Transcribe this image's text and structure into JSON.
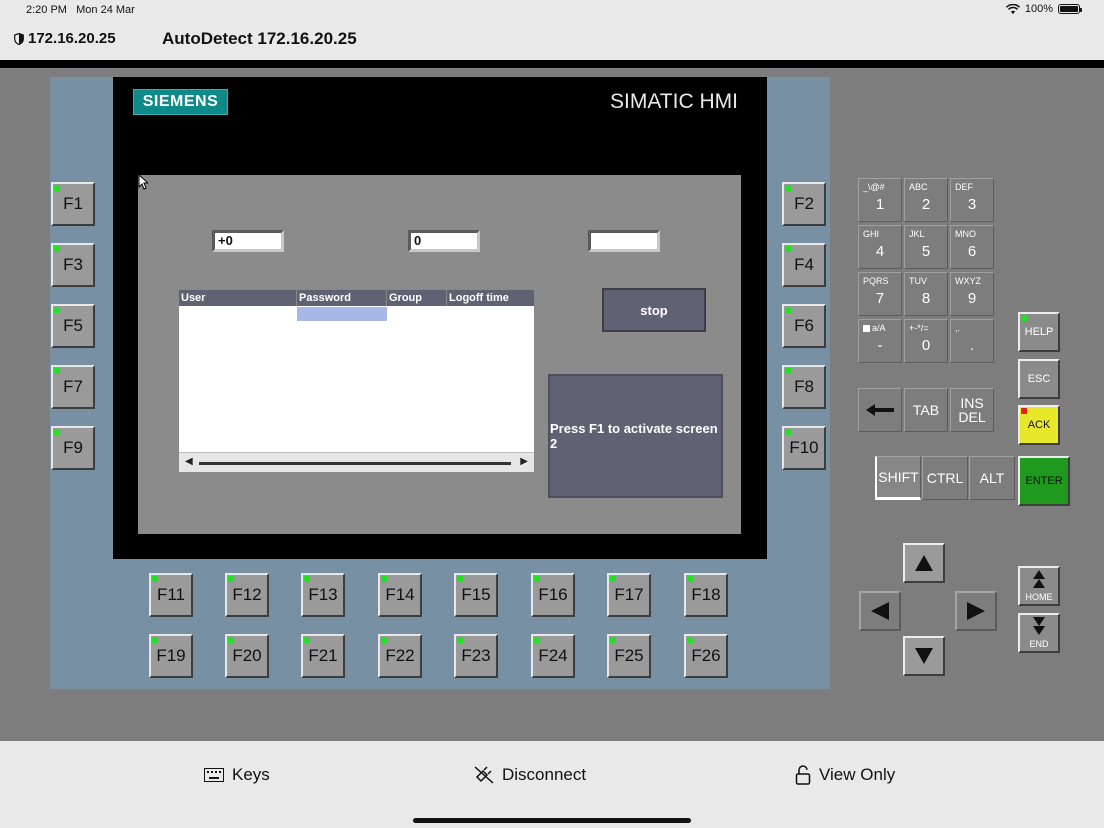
{
  "status": {
    "time": "2:20 PM",
    "date": "Mon 24 Mar",
    "battery": "100%"
  },
  "header": {
    "ip": "172.16.20.25",
    "title": "AutoDetect 172.16.20.25"
  },
  "hmi": {
    "brand_logo": "SIEMENS",
    "brand_product": "SIMATIC HMI",
    "fields": [
      "+0",
      "0",
      ""
    ],
    "stop_label": "stop",
    "press_label": "Press F1 to activate screen 2",
    "table": {
      "columns": [
        "User",
        "Password",
        "Group",
        "Logoff time"
      ]
    }
  },
  "fkeys": {
    "left": [
      "F1",
      "F3",
      "F5",
      "F7",
      "F9"
    ],
    "right": [
      "F2",
      "F4",
      "F6",
      "F8",
      "F10"
    ],
    "bottom_row1": [
      "F11",
      "F12",
      "F13",
      "F14",
      "F15",
      "F16",
      "F17",
      "F18"
    ],
    "bottom_row2": [
      "F19",
      "F20",
      "F21",
      "F22",
      "F23",
      "F24",
      "F25",
      "F26"
    ]
  },
  "keypad": {
    "keys": [
      {
        "sub": "_\\@#",
        "main": "1"
      },
      {
        "sub": "ABC",
        "main": "2"
      },
      {
        "sub": "DEF",
        "main": "3"
      },
      {
        "sub": "GHI",
        "main": "4"
      },
      {
        "sub": "JKL",
        "main": "5"
      },
      {
        "sub": "MNO",
        "main": "6"
      },
      {
        "sub": "PQRS",
        "main": "7"
      },
      {
        "sub": "TUV",
        "main": "8"
      },
      {
        "sub": "WXYZ",
        "main": "9"
      },
      {
        "sub": "a/A",
        "main": "-"
      },
      {
        "sub": "+-*/=",
        "main": "0"
      },
      {
        "sub": ",.",
        "main": "."
      }
    ],
    "tab": "TAB",
    "ins": "INS",
    "del": "DEL",
    "shift": "SHIFT",
    "ctrl": "CTRL",
    "alt": "ALT",
    "help": "HELP",
    "esc": "ESC",
    "ack": "ACK",
    "enter": "ENTER",
    "home": "HOME",
    "end": "END"
  },
  "bottombar": {
    "keys": "Keys",
    "disconnect": "Disconnect",
    "viewonly": "View Only"
  },
  "colors": {
    "led": "#22e022",
    "ack": "#e8e82a",
    "enter": "#1f9a1f",
    "siemens": "#0e8a89",
    "panel_blue": "#7790a3"
  }
}
